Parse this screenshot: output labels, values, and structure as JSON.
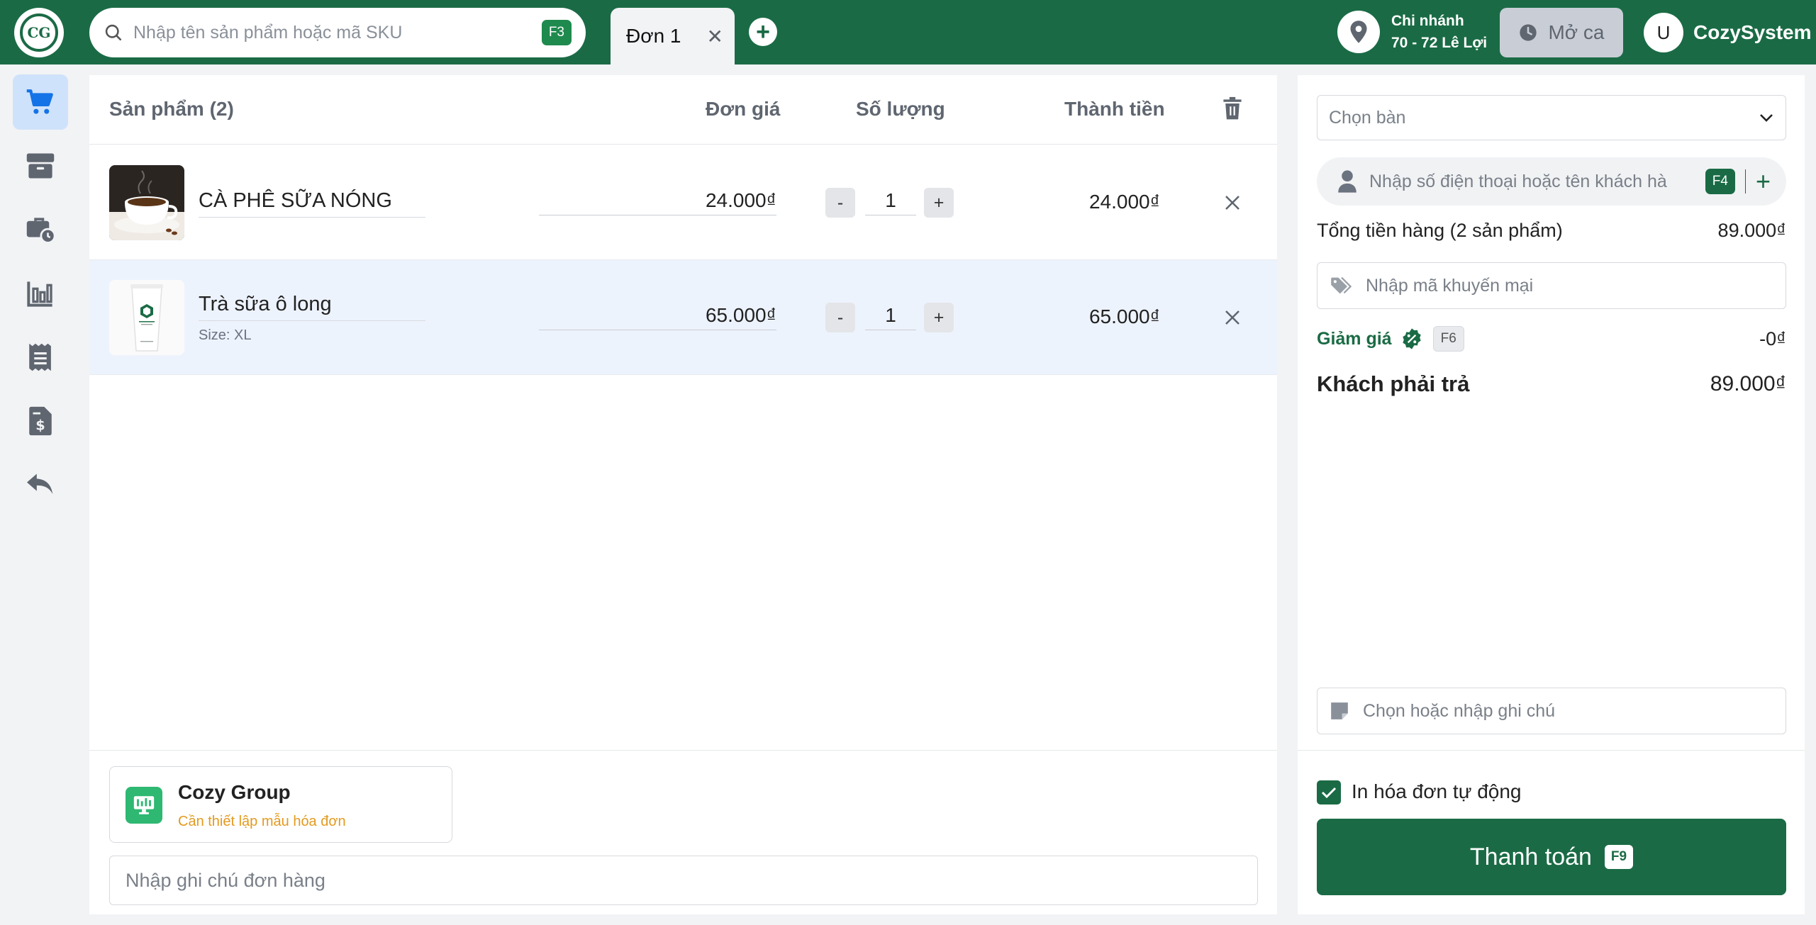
{
  "header": {
    "logo_text": "CG",
    "search_placeholder": "Nhập tên sản phẩm hoặc mã SKU",
    "search_key": "F3",
    "tab_label": "Đơn 1",
    "branch_title": "Chi nhánh",
    "branch_address": "70 - 72 Lê Lợi",
    "shift_label": "Mở ca",
    "avatar_initial": "U",
    "user_name": "CozySystem"
  },
  "nav": {
    "items": [
      "cart-icon",
      "box-icon",
      "briefcase-clock-icon",
      "bar-chart-icon",
      "receipt-icon",
      "invoice-dollar-icon",
      "undo-icon"
    ],
    "active": "cart-icon"
  },
  "table": {
    "headers": {
      "product": "Sản phẩm (2)",
      "unit_price": "Đơn giá",
      "quantity": "Số lượng",
      "total": "Thành tiền"
    },
    "rows": [
      {
        "name": "CÀ PHÊ SỮA NÓNG",
        "size": "",
        "price": "24.000₫",
        "qty": "1",
        "total": "24.000₫",
        "dec": "-",
        "inc": "+"
      },
      {
        "name": "Trà sữa ô long",
        "size": "Size: XL",
        "price": "65.000₫",
        "qty": "1",
        "total": "65.000₫",
        "dec": "-",
        "inc": "+"
      }
    ]
  },
  "footer": {
    "store_name": "Cozy Group",
    "store_note": "Cần thiết lập mẫu hóa đơn",
    "order_note_placeholder": "Nhập ghi chú đơn hàng"
  },
  "side": {
    "table_select": "Chọn bàn",
    "customer_placeholder": "Nhập số điện thoại hoặc tên khách hà",
    "customer_key": "F4",
    "subtotal_label": "Tổng tiền hàng (2 sản phẩm)",
    "subtotal_value": "89.000₫",
    "promo_placeholder": "Nhập mã khuyến mại",
    "discount_label": "Giảm giá",
    "discount_key": "F6",
    "discount_value": "-0₫",
    "pay_label_text": "Khách phải trả",
    "pay_value": "89.000₫",
    "note_placeholder": "Chọn hoặc nhập ghi chú",
    "auto_print_label": "In hóa đơn tự động",
    "auto_print_checked": true,
    "checkout_label": "Thanh toán",
    "checkout_key": "F9"
  },
  "colors": {
    "brand": "#1a6b45",
    "accent_badge": "#1e8a4d",
    "warning_text": "#e39a1e",
    "active_nav": "#cfe2fb"
  }
}
